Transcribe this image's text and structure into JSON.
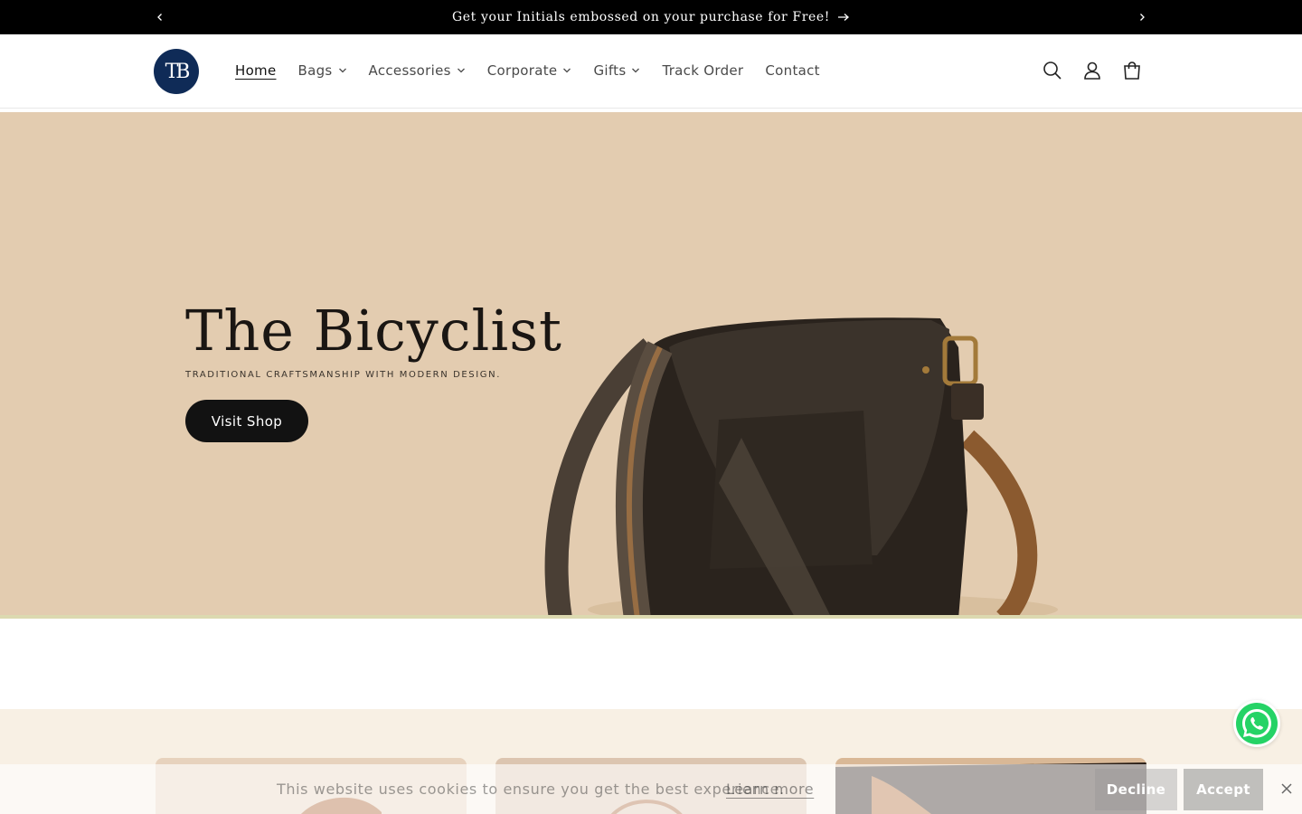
{
  "announcement": {
    "message": "Get your Initials embossed on your purchase for Free!",
    "prev_icon": "chevron-left-icon",
    "next_icon": "chevron-right-icon"
  },
  "header": {
    "logo_text": "TB",
    "nav": [
      {
        "label": "Home",
        "has_dropdown": false,
        "active": true
      },
      {
        "label": "Bags",
        "has_dropdown": true
      },
      {
        "label": "Accessories",
        "has_dropdown": true
      },
      {
        "label": "Corporate",
        "has_dropdown": true
      },
      {
        "label": "Gifts",
        "has_dropdown": true
      },
      {
        "label": "Track Order",
        "has_dropdown": false
      },
      {
        "label": "Contact",
        "has_dropdown": false
      }
    ],
    "icons": [
      "search-icon",
      "account-icon",
      "cart-icon"
    ]
  },
  "hero": {
    "title": "The Bicyclist",
    "subtitle": "TRADITIONAL CRAFTSMANSHIP WITH MODERN DESIGN.",
    "button_label": "Visit Shop",
    "background_color": "#e3ccb0"
  },
  "cookie_banner": {
    "text": "This website uses cookies to ensure you get the best experience.",
    "learn_more": "Learn more",
    "decline": "Decline",
    "accept": "Accept"
  },
  "colors": {
    "announcement_bg": "#000000",
    "logo_bg": "#0f2b57",
    "button_bg": "#121212",
    "whatsapp": "#25d366",
    "collection_bg": "#f8f0e4"
  }
}
